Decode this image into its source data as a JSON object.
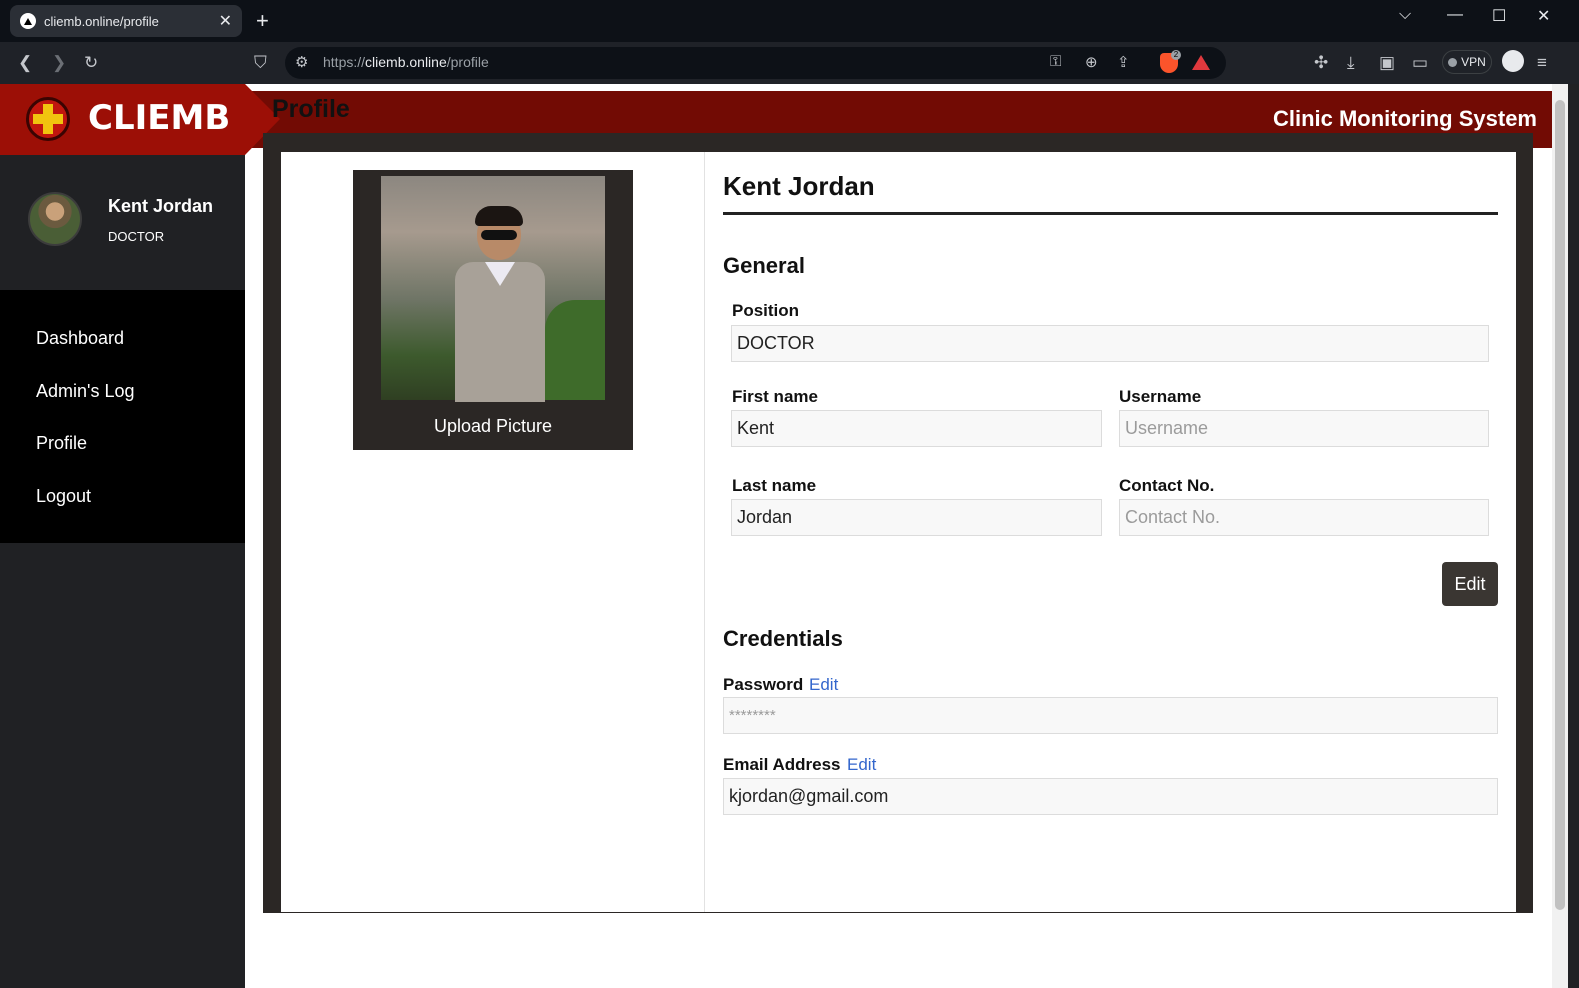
{
  "browser": {
    "tab_title": "cliemb.online/profile",
    "url_scheme": "https://",
    "url_host": "cliemb.online",
    "url_path": "/profile",
    "vpn_label": "VPN",
    "brave_badge": "2"
  },
  "header": {
    "logo_text": "CLIEMB",
    "system_title": "Clinic Monitoring System"
  },
  "sidebar": {
    "user_name": "Kent Jordan",
    "user_role": "DOCTOR",
    "items": [
      {
        "label": "Dashboard"
      },
      {
        "label": "Admin's Log"
      },
      {
        "label": "Profile"
      },
      {
        "label": "Logout"
      }
    ]
  },
  "page": {
    "title": "Profile",
    "upload_label": "Upload Picture",
    "profile_name": "Kent Jordan",
    "general_heading": "General",
    "credentials_heading": "Credentials",
    "edit_button": "Edit"
  },
  "form": {
    "position_label": "Position",
    "position_value": "DOCTOR",
    "first_name_label": "First name",
    "first_name_value": "Kent",
    "username_label": "Username",
    "username_value": "",
    "username_placeholder": "Username",
    "last_name_label": "Last name",
    "last_name_value": "Jordan",
    "contact_label": "Contact No.",
    "contact_value": "",
    "contact_placeholder": "Contact No.",
    "password_label": "Password",
    "password_edit": "Edit",
    "password_value": "********",
    "email_label": "Email Address",
    "email_edit": "Edit",
    "email_value": "kjordan@gmail.com"
  },
  "colors": {
    "header_bg": "#720b04",
    "logo_bg": "#9c0f06",
    "sidebar_bg": "#202124",
    "nav_bg": "#000000",
    "frame_bg": "#2b2725",
    "link": "#3366cc"
  }
}
